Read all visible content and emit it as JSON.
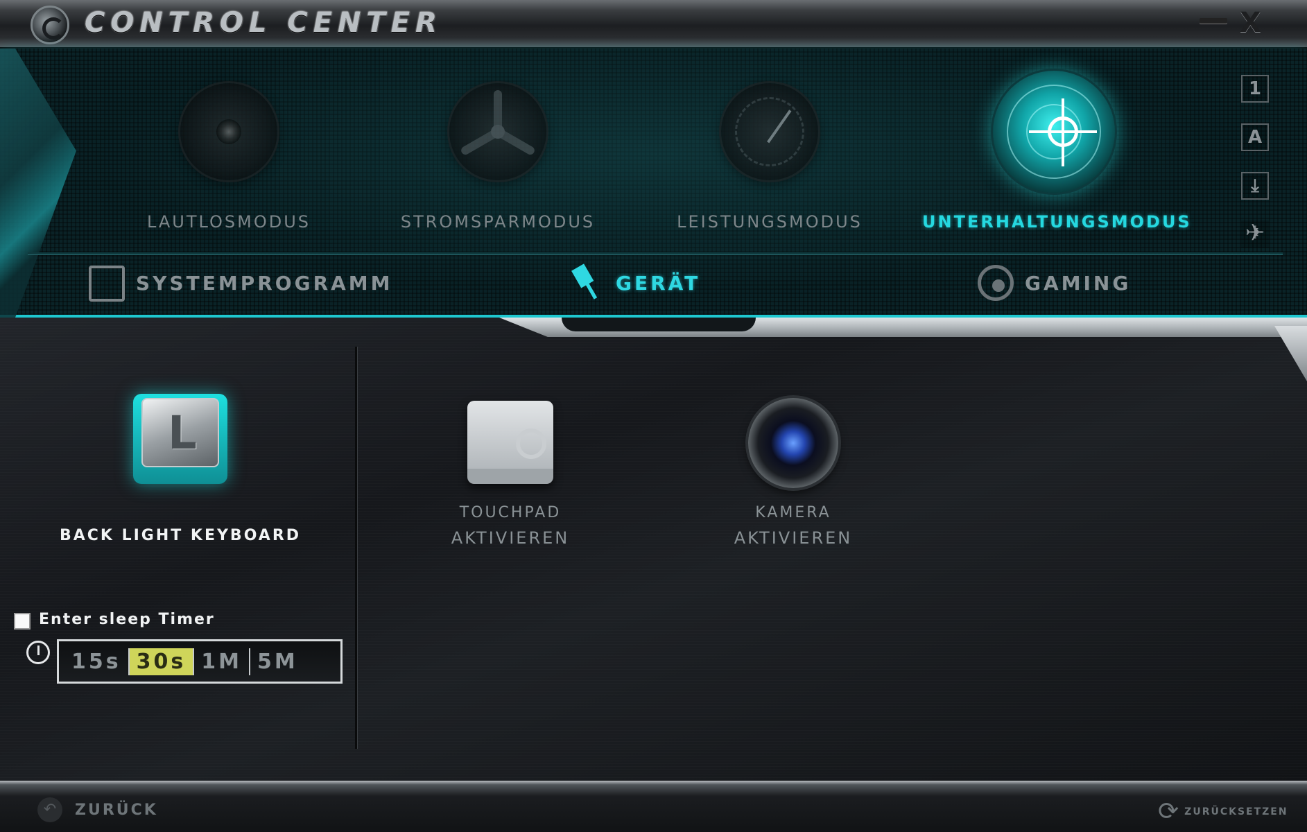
{
  "titlebar": {
    "title": "CONTROL CENTER",
    "minimize_icon": "minimize-icon",
    "close_label": "X"
  },
  "modes": [
    {
      "label": "Lautlosmodus",
      "icon": "speaker-icon",
      "active": false
    },
    {
      "label": "Stromsparmodus",
      "icon": "fan-icon",
      "active": false
    },
    {
      "label": "Leistungsmodus",
      "icon": "gauge-icon",
      "active": false
    },
    {
      "label": "Unterhaltungsmodus",
      "icon": "crosshair-icon",
      "active": true
    }
  ],
  "side_icons": [
    {
      "label": "1",
      "icon": "profile-1-icon"
    },
    {
      "label": "A",
      "icon": "profile-a-icon"
    },
    {
      "label": "⤓",
      "icon": "download-icon"
    },
    {
      "label": "✈",
      "icon": "airplane-icon"
    }
  ],
  "nav": {
    "tabs": [
      {
        "label": "SYSTEMPROGRAMM",
        "icon": "monitor-icon",
        "active": false
      },
      {
        "label": "GERÄT",
        "icon": "plug-icon",
        "active": true
      },
      {
        "label": "GAMING",
        "icon": "steering-wheel-icon",
        "active": false
      }
    ]
  },
  "keyboard": {
    "key_letter": "L",
    "label": "BACK LIGHT KEYBOARD"
  },
  "sleep_timer": {
    "checkbox_label": "Enter sleep Timer",
    "checked": false,
    "options": [
      "15s",
      "30s",
      "1M",
      "5M"
    ],
    "selected": "30s"
  },
  "devices": [
    {
      "line1": "TouchPad",
      "line2": "AKTIVIEREN",
      "icon": "touchpad-icon"
    },
    {
      "line1": "Kamera",
      "line2": "AKTIVIEREN",
      "icon": "camera-icon"
    }
  ],
  "footer": {
    "back_label": "ZURÜCK",
    "reset_label": "ZURÜCKSETZEN"
  },
  "colors": {
    "accent": "#25d8e0",
    "timer_selected": "#cfd55a"
  }
}
